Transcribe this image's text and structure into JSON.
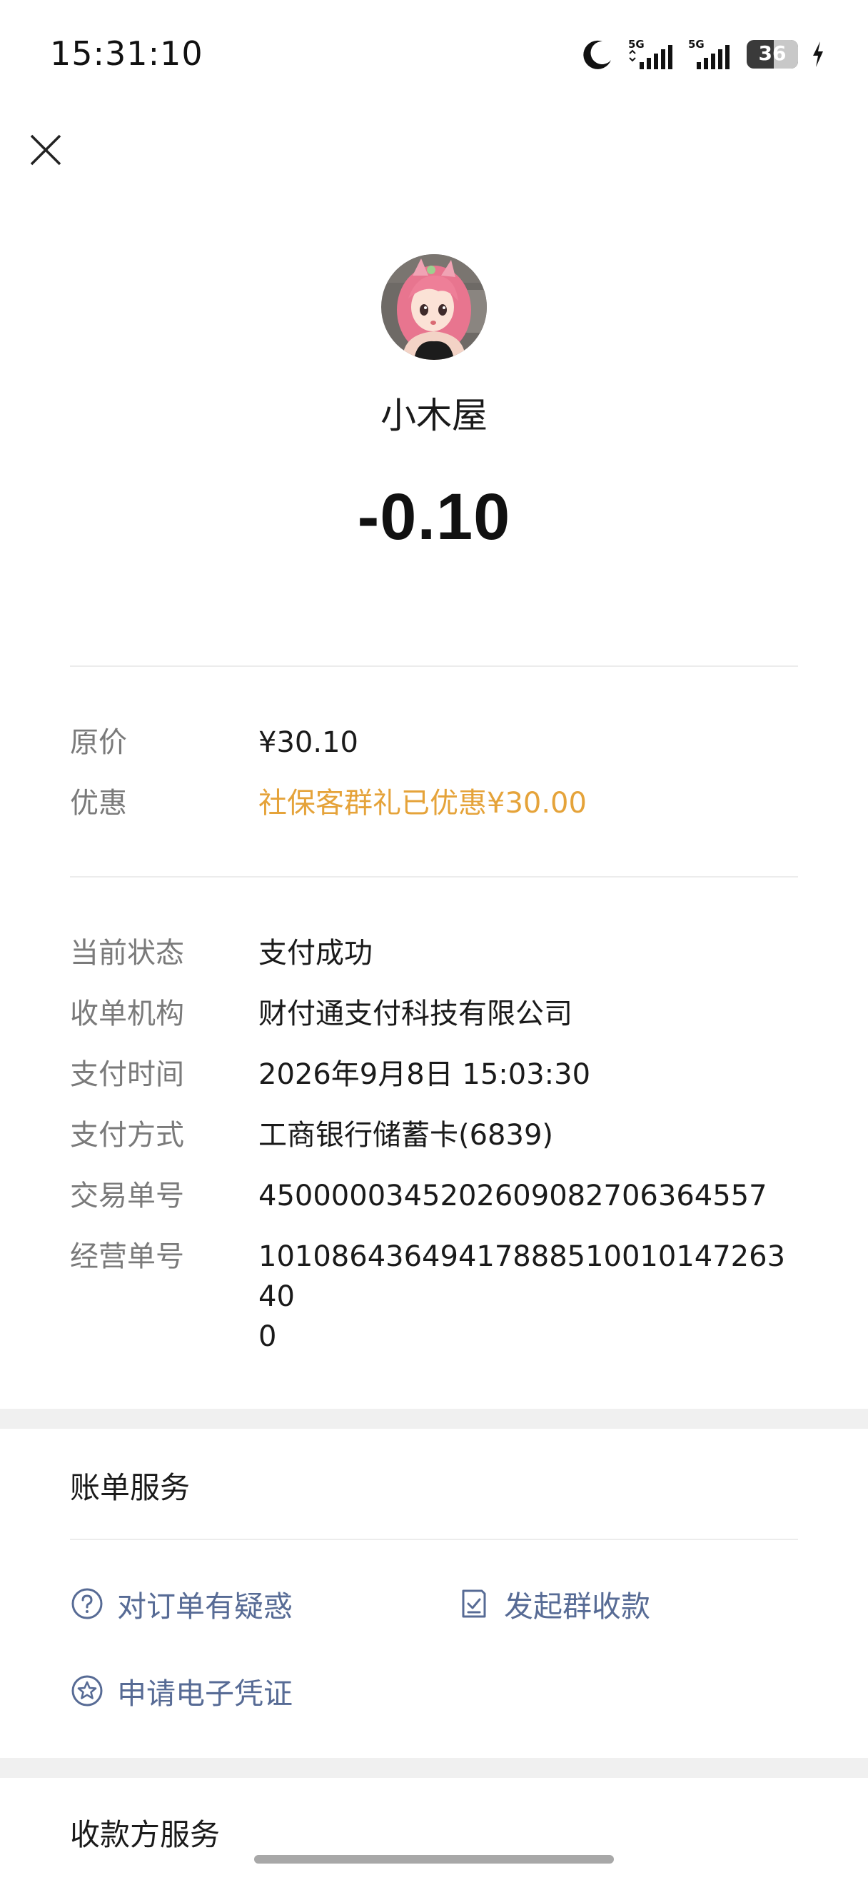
{
  "status_bar": {
    "time": "15:31:10",
    "network_1": "5G",
    "network_2": "5G",
    "battery": "36"
  },
  "merchant": {
    "name": "小木屋",
    "amount": "-0.10"
  },
  "price_section": [
    {
      "label": "原价",
      "value": "¥30.10"
    },
    {
      "label": "优惠",
      "value": "社保客群礼已优惠¥30.00"
    }
  ],
  "details": [
    {
      "label": "当前状态",
      "value": "支付成功"
    },
    {
      "label": "收单机构",
      "value": "财付通支付科技有限公司"
    },
    {
      "label": "支付时间",
      "value": "2026年9月8日 15:03:30"
    },
    {
      "label": "支付方式",
      "value": "工商银行储蓄卡(6839)"
    },
    {
      "label": "交易单号",
      "value": "4500000345202609082706364557"
    },
    {
      "label": "经营单号",
      "value": "1010864364941788851001014726340\n0"
    }
  ],
  "bill_services": {
    "title": "账单服务",
    "items": [
      {
        "label": "对订单有疑惑",
        "icon": "question-circle-icon"
      },
      {
        "label": "发起群收款",
        "icon": "receipt-icon"
      },
      {
        "label": "申请电子凭证",
        "icon": "star-badge-icon"
      }
    ]
  },
  "payee_services": {
    "title": "收款方服务"
  },
  "colors": {
    "discount": "#e5a33a",
    "link": "#576b95",
    "label": "#7a7a7a"
  }
}
